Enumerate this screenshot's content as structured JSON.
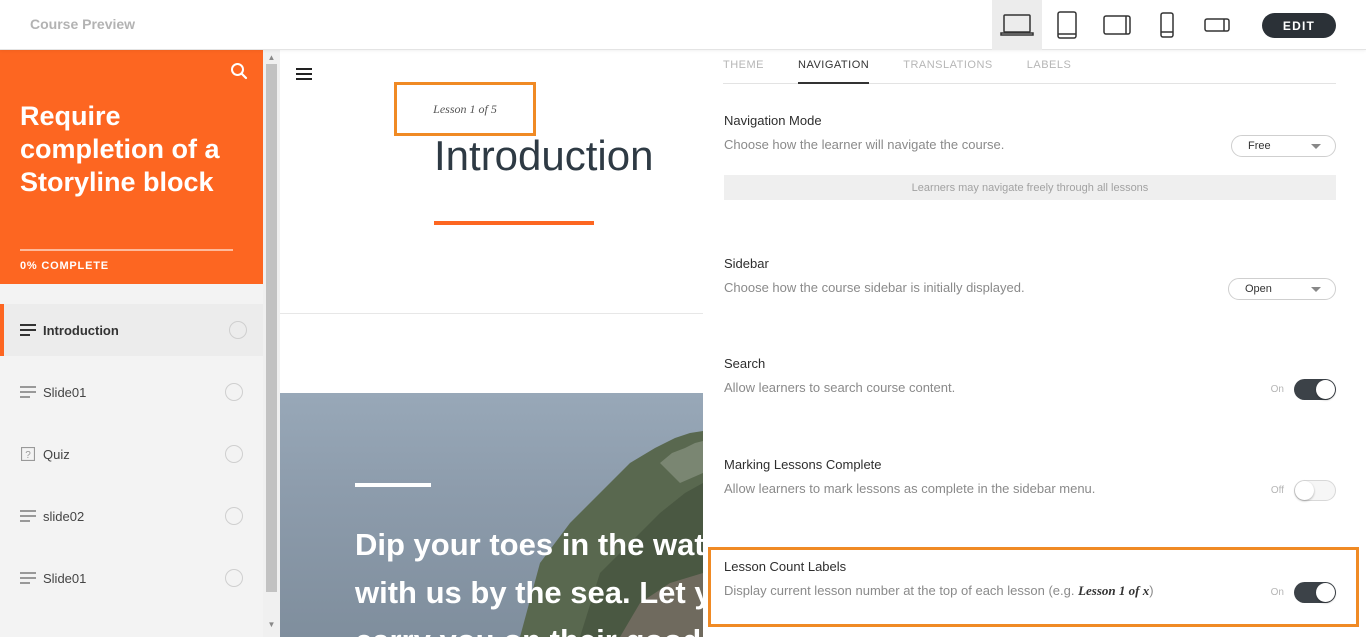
{
  "app": {
    "title": "Course Preview"
  },
  "devices": [
    {
      "name": "desktop",
      "icon": "laptop-icon",
      "active": true
    },
    {
      "name": "tablet-portrait",
      "icon": "tablet-portrait-icon",
      "active": false
    },
    {
      "name": "tablet-landscape",
      "icon": "tablet-landscape-icon",
      "active": false
    },
    {
      "name": "phone-portrait",
      "icon": "phone-portrait-icon",
      "active": false
    },
    {
      "name": "phone-landscape",
      "icon": "phone-landscape-icon",
      "active": false
    }
  ],
  "toolbar": {
    "edit_label": "EDIT"
  },
  "sidebar": {
    "course_title": "Require completion of a Storyline block",
    "progress_label": "0% COMPLETE",
    "progress": 0,
    "lessons": [
      {
        "label": "Introduction",
        "icon": "text-lines-icon",
        "active": true
      },
      {
        "label": "Slide01",
        "icon": "text-lines-icon",
        "active": false
      },
      {
        "label": "Quiz",
        "icon": "quiz-icon",
        "active": false
      },
      {
        "label": "slide02",
        "icon": "text-lines-icon",
        "active": false
      },
      {
        "label": "Slide01",
        "icon": "text-lines-icon",
        "active": false
      }
    ]
  },
  "main": {
    "lesson_count": "Lesson 1 of 5",
    "lesson_title": "Introduction",
    "hero_lines": [
      "Dip your toes in the water",
      "with us by the sea. Let your",
      "carry you on their good looks"
    ]
  },
  "panel": {
    "tabs": [
      {
        "label": "THEME",
        "active": false
      },
      {
        "label": "NAVIGATION",
        "active": true
      },
      {
        "label": "TRANSLATIONS",
        "active": false
      },
      {
        "label": "LABELS",
        "active": false
      }
    ],
    "navigation_mode": {
      "title": "Navigation Mode",
      "description": "Choose how the learner will navigate the course.",
      "value": "Free",
      "info": "Learners may navigate freely through all lessons"
    },
    "sidebar_setting": {
      "title": "Sidebar",
      "description": "Choose how the course sidebar is initially displayed.",
      "value": "Open"
    },
    "search_setting": {
      "title": "Search",
      "description": "Allow learners to search course content.",
      "state_label": "On",
      "on": true
    },
    "marking_setting": {
      "title": "Marking Lessons Complete",
      "description": "Allow learners to mark lessons as complete in the sidebar menu.",
      "state_label": "Off",
      "on": false
    },
    "lesson_count_setting": {
      "title": "Lesson Count Labels",
      "description_prefix": "Display current lesson number at the top of each lesson (e.g. ",
      "description_example": "Lesson 1 of x",
      "description_suffix": ")",
      "state_label": "On",
      "on": true
    }
  },
  "colors": {
    "accent": "#fd6621",
    "highlight": "#f08a24",
    "dark": "#2b3137"
  }
}
